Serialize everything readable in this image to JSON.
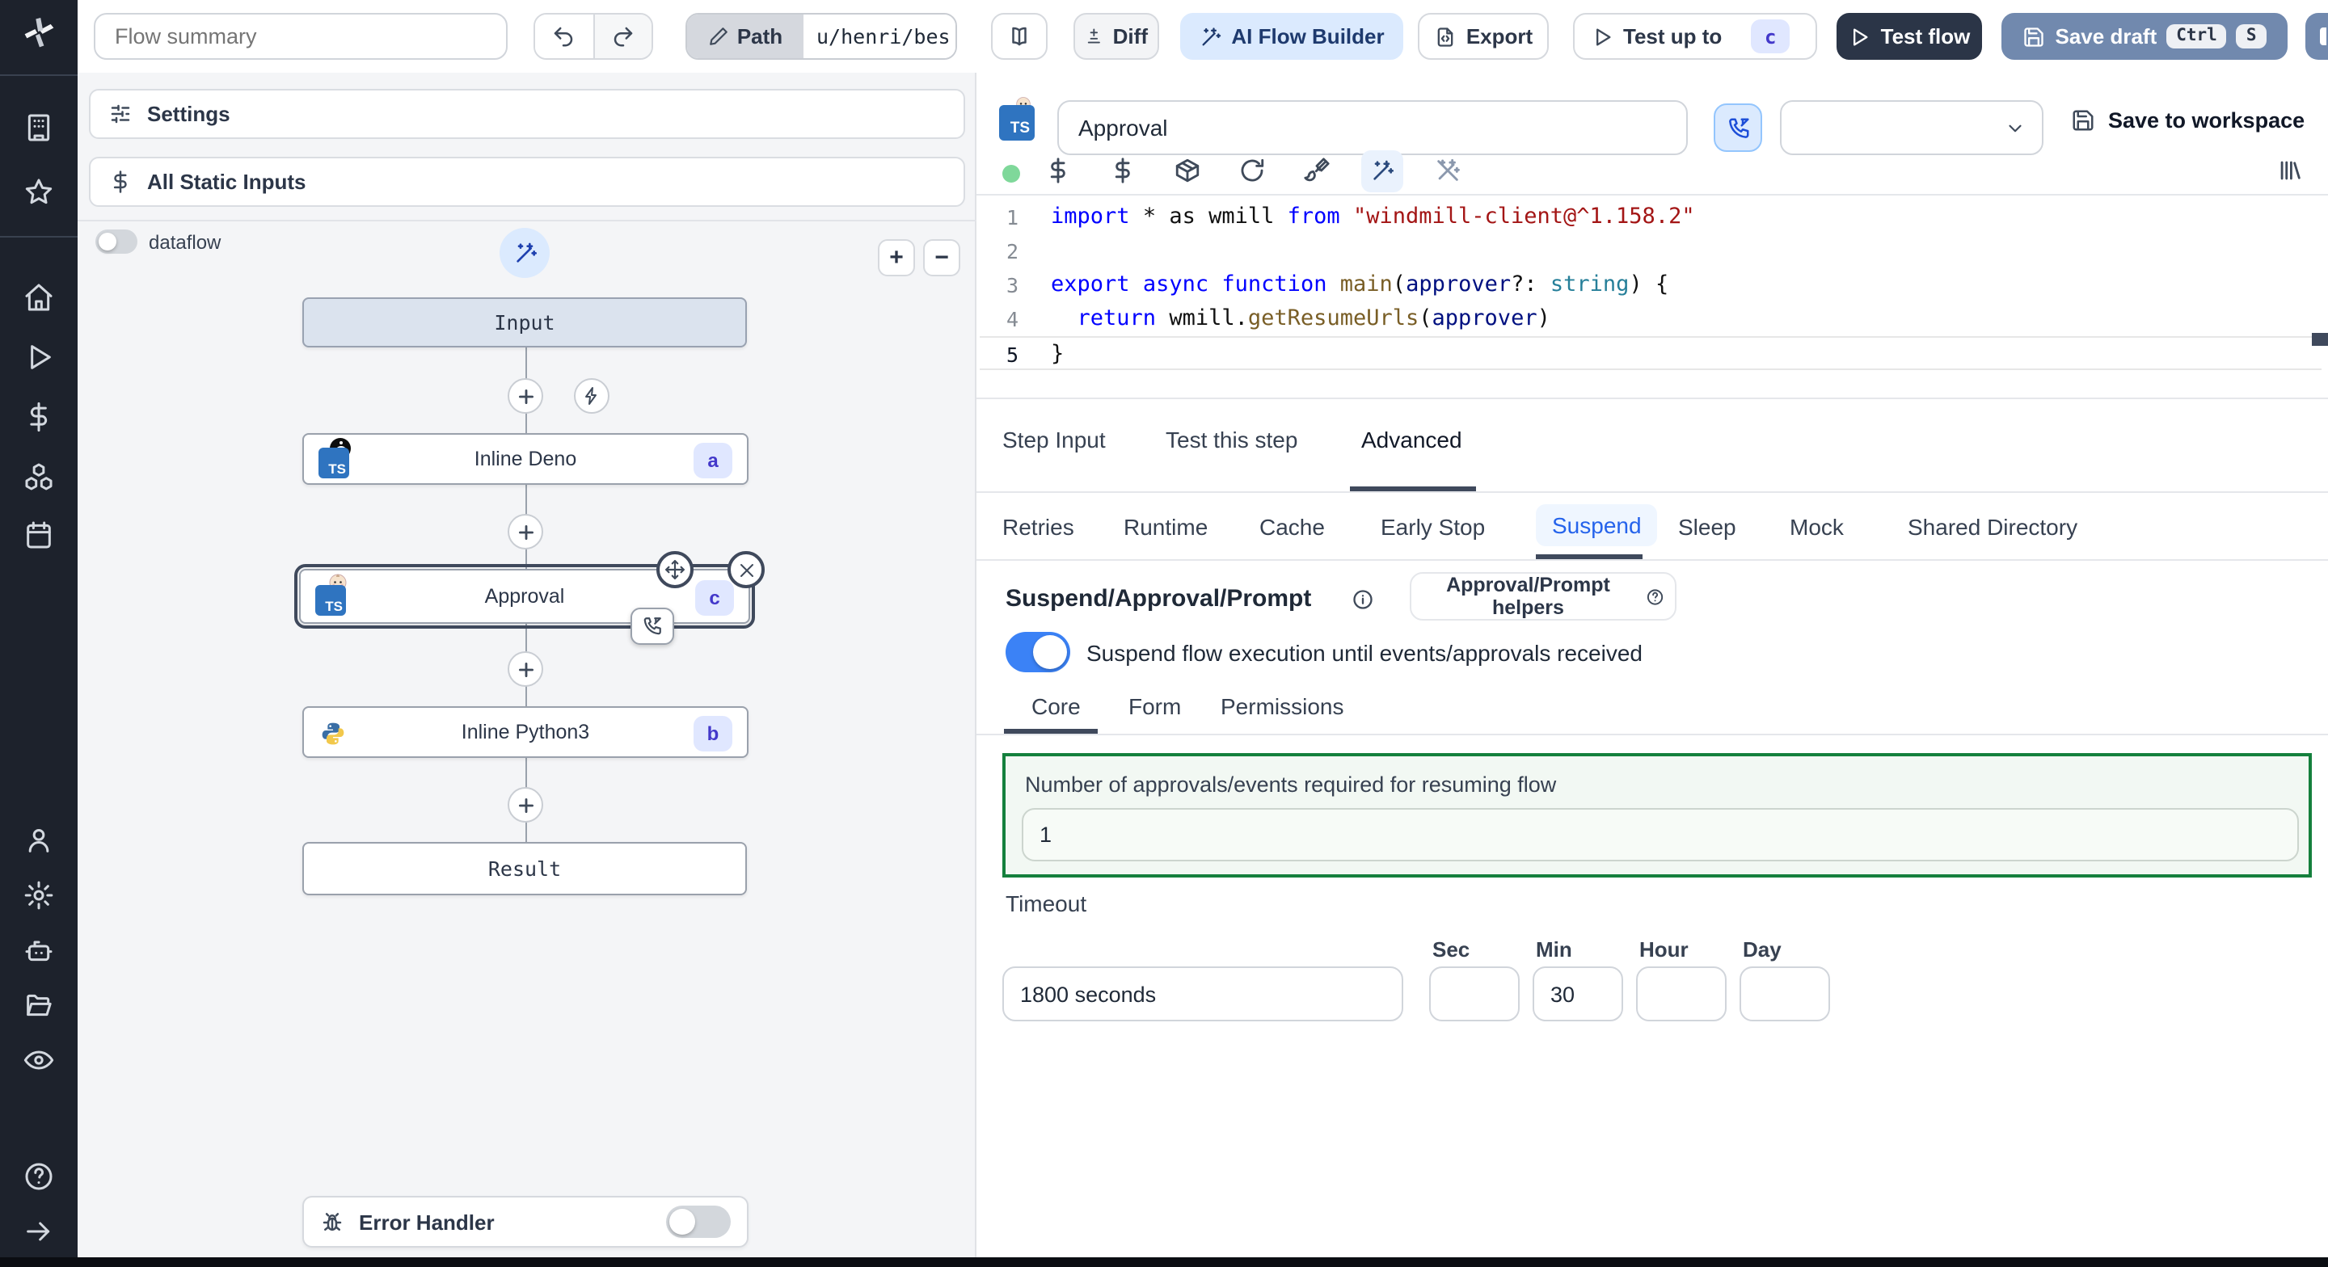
{
  "topbar": {
    "flow_summary_placeholder": "Flow summary",
    "path_label": "Path",
    "path_value": "u/henri/bes",
    "diff_label": "Diff",
    "ai_flow_builder_label": "AI Flow Builder",
    "export_label": "Export",
    "test_up_to_label": "Test up to",
    "test_up_to_badge": "c",
    "test_flow_label": "Test flow",
    "save_draft_label": "Save draft",
    "kbd_ctrl": "Ctrl",
    "kbd_s": "S"
  },
  "flow_panel": {
    "settings_label": "Settings",
    "all_static_inputs_label": "All Static Inputs",
    "dataflow_label": "dataflow",
    "zoom_in": "+",
    "zoom_out": "−",
    "nodes": {
      "input": "Input",
      "inline_deno": {
        "label": "Inline Deno",
        "badge": "a"
      },
      "approval": {
        "label": "Approval",
        "badge": "c"
      },
      "inline_python": {
        "label": "Inline Python3",
        "badge": "b"
      },
      "result": "Result"
    },
    "error_handler_label": "Error Handler"
  },
  "step_panel": {
    "name_value": "Approval",
    "save_to_workspace_label": "Save to workspace",
    "tabs": {
      "step_input": "Step Input",
      "test_this_step": "Test this step",
      "advanced": "Advanced"
    },
    "subtabs": {
      "retries": "Retries",
      "runtime": "Runtime",
      "cache": "Cache",
      "early_stop": "Early Stop",
      "suspend": "Suspend",
      "sleep": "Sleep",
      "mock": "Mock",
      "shared_directory": "Shared Directory"
    },
    "code": {
      "current_line": 5,
      "lines": [
        [
          {
            "c": "kw",
            "t": "import"
          },
          {
            "c": "pl",
            "t": " * as wmill "
          },
          {
            "c": "kw",
            "t": "from"
          },
          {
            "c": "str",
            "t": " \"windmill-client@^1.158.2\""
          }
        ],
        [],
        [
          {
            "c": "kw",
            "t": "export"
          },
          {
            "c": "pl",
            "t": " "
          },
          {
            "c": "kw",
            "t": "async"
          },
          {
            "c": "pl",
            "t": " "
          },
          {
            "c": "kw",
            "t": "function"
          },
          {
            "c": "pl",
            "t": " "
          },
          {
            "c": "fn",
            "t": "main"
          },
          {
            "c": "pl",
            "t": "("
          },
          {
            "c": "var",
            "t": "approver"
          },
          {
            "c": "pl",
            "t": "?: "
          },
          {
            "c": "type",
            "t": "string"
          },
          {
            "c": "pl",
            "t": ") {"
          }
        ],
        [
          {
            "c": "pl",
            "t": "  "
          },
          {
            "c": "kw",
            "t": "return"
          },
          {
            "c": "pl",
            "t": " wmill."
          },
          {
            "c": "fn",
            "t": "getResumeUrls"
          },
          {
            "c": "pl",
            "t": "("
          },
          {
            "c": "var",
            "t": "approver"
          },
          {
            "c": "pl",
            "t": ")"
          }
        ],
        [
          {
            "c": "pl",
            "t": "}"
          }
        ]
      ]
    },
    "suspend": {
      "heading": "Suspend/Approval/Prompt",
      "helpers_button_label": "Approval/Prompt helpers",
      "toggle_label": "Suspend flow execution until events/approvals received",
      "tabs": {
        "core": "Core",
        "form": "Form",
        "permissions": "Permissions"
      },
      "approvals_label": "Number of approvals/events required for resuming flow",
      "approvals_value": "1",
      "timeout_label": "Timeout",
      "timeout_value": "1800 seconds",
      "sec_label": "Sec",
      "min_label": "Min",
      "hour_label": "Hour",
      "day_label": "Day",
      "sec_value": "",
      "min_value": "30",
      "hour_value": "",
      "day_value": ""
    }
  },
  "colors": {
    "sidebar_bg": "#1d222c",
    "accent_toggle_on": "#3b82f6",
    "ai_button_bg": "#dbeafe",
    "test_flow_bg": "#2b3547",
    "save_draft_bg": "#7189ae",
    "suspend_tab_text": "#2563eb",
    "approvals_box_border": "#15803d",
    "badge_bg": "#e0e7ff",
    "badge_text": "#4338ca"
  }
}
